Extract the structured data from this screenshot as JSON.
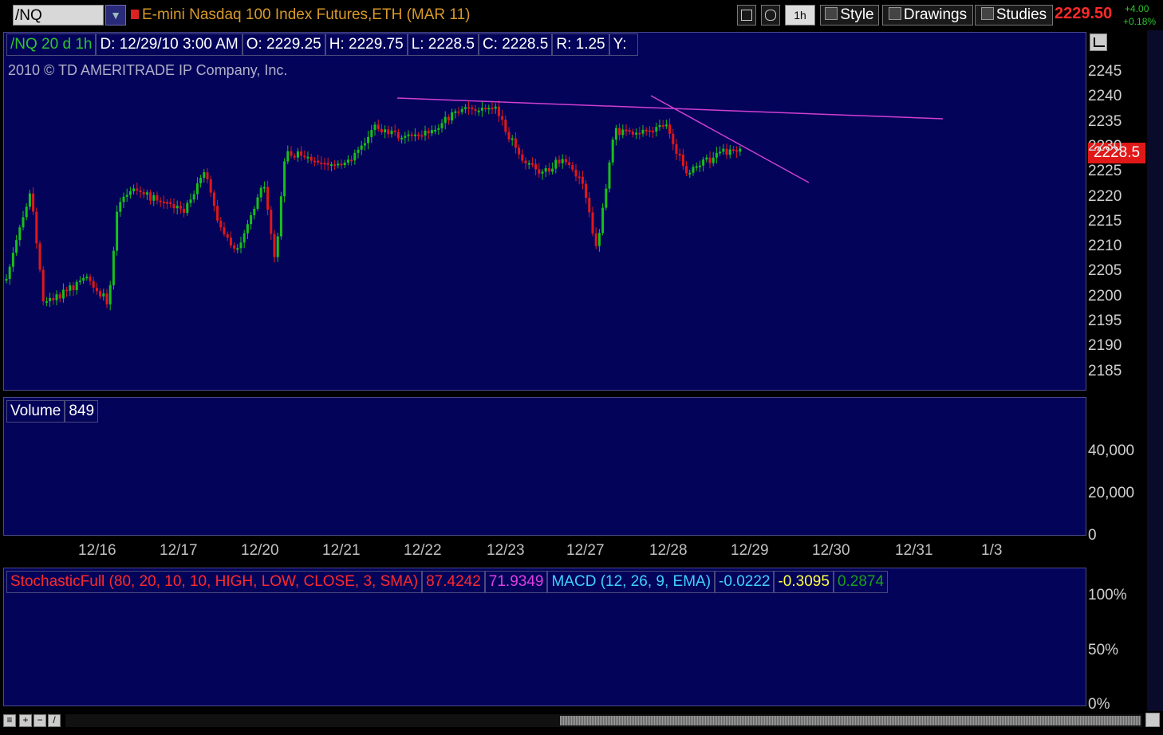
{
  "toolbar": {
    "symbol": "/NQ",
    "title": "E-mini Nasdaq 100 Index Futures,ETH (MAR 11)",
    "period_button": "1h",
    "style_label": "Style",
    "drawings_label": "Drawings",
    "studies_label": "Studies",
    "last_price": "2229.50",
    "change_abs": "+4.00",
    "change_pct": "+0.18%"
  },
  "price_panel": {
    "header": {
      "symbol_period": "/NQ 20 d 1h",
      "date": "D: 12/29/10 3:00 AM",
      "open": "O: 2229.25",
      "high": "H: 2229.75",
      "low": "L: 2228.5",
      "close": "C: 2228.5",
      "range": "R: 1.25",
      "y": "Y:"
    },
    "watermark": "2010 © TD AMERITRADE IP Company, Inc.",
    "price_label": "2228.5",
    "y_ticks": [
      "2245",
      "2240",
      "2235",
      "2230",
      "2225",
      "2220",
      "2215",
      "2210",
      "2205",
      "2200",
      "2195",
      "2190",
      "2185"
    ]
  },
  "volume_panel": {
    "label": "Volume",
    "value": "849",
    "y_ticks": [
      "40,000",
      "20,000",
      "0"
    ]
  },
  "x_ticks": [
    "12/16",
    "12/17",
    "12/20",
    "12/21",
    "12/22",
    "12/23",
    "12/27",
    "12/28",
    "12/29",
    "12/30",
    "12/31",
    "1/3"
  ],
  "indicator_panel": {
    "stoch_label": "StochasticFull (80, 20, 10, 10, HIGH, LOW, CLOSE, 3, SMA)",
    "stoch_k": "87.4242",
    "stoch_d": "71.9349",
    "macd_label": "MACD (12, 26, 9, EMA)",
    "macd_value": "-0.0222",
    "macd_avg": "-0.3095",
    "macd_diff": "0.2874",
    "y_ticks": [
      "100%",
      "50%",
      "0%"
    ]
  },
  "colors": {
    "background": "#03035a",
    "up_candle": "#18c018",
    "down_candle": "#e01818",
    "trendline": "#d040d0",
    "axis_text": "#d0d0d0",
    "title": "#d89a2a",
    "stoch_k": "#e01818",
    "stoch_d": "#e040e0",
    "macd": "#40d0ff",
    "macd_avg": "#ffff40",
    "macd_diff": "#18a018"
  },
  "icons": [
    "dropdown-icon",
    "crosshair-icon",
    "zoom-icon",
    "style-icon",
    "drawings-icon",
    "studies-icon",
    "chart-settings-icon",
    "zoom-in-icon",
    "zoom-out-icon"
  ]
}
